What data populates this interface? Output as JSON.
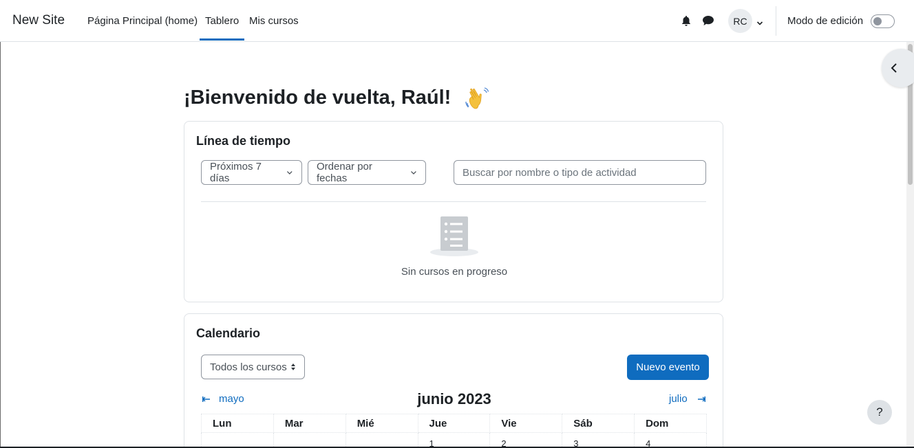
{
  "navbar": {
    "brand": "New Site",
    "links": [
      "Página Principal (home)",
      "Tablero",
      "Mis cursos"
    ],
    "active_link": "Tablero",
    "user_initials": "RC",
    "edit_mode_label": "Modo de edición",
    "edit_mode_on": false
  },
  "page": {
    "title": "¡Bienvenido de vuelta, Raúl!",
    "title_emoji": "waving-hand-icon"
  },
  "timeline": {
    "title": "Línea de tiempo",
    "filter_label": "Próximos 7 días",
    "sort_label": "Ordenar por fechas",
    "search_placeholder": "Buscar por nombre o tipo de actividad",
    "empty_message": "Sin cursos en progreso"
  },
  "calendar": {
    "title": "Calendario",
    "course_select": "Todos los cursos",
    "new_event_label": "Nuevo evento",
    "prev_month": "mayo",
    "next_month": "julio",
    "current_month": "junio 2023",
    "weekdays": [
      "Lun",
      "Mar",
      "Mié",
      "Jue",
      "Vie",
      "Sáb",
      "Dom"
    ],
    "first_week": [
      "",
      "",
      "",
      "1",
      "2",
      "3",
      "4"
    ]
  },
  "help_label": "?",
  "colors": {
    "primary": "#0f6cbf",
    "text": "#1d2125",
    "border": "#dee2e6"
  }
}
